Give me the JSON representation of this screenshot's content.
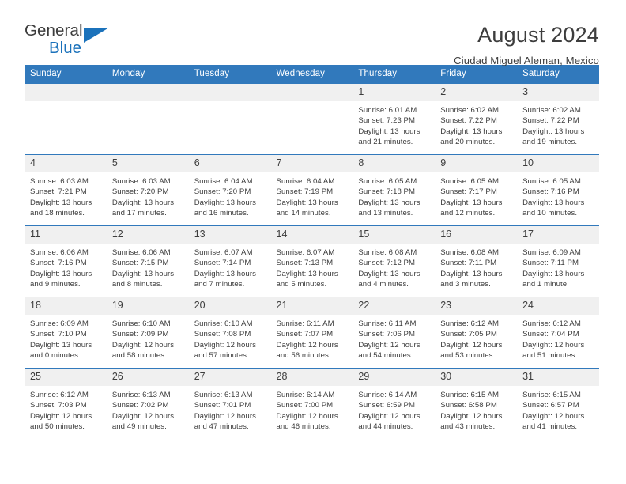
{
  "brand": {
    "name_part1": "General",
    "name_part2": "Blue",
    "accent_color": "#1b72bb"
  },
  "header": {
    "title": "August 2024",
    "subtitle": "Ciudad Miguel Aleman, Mexico"
  },
  "calendar": {
    "header_bg": "#3179bc",
    "daynum_bg": "#f0f0f0",
    "weekdays": [
      "Sunday",
      "Monday",
      "Tuesday",
      "Wednesday",
      "Thursday",
      "Friday",
      "Saturday"
    ],
    "weeks": [
      [
        {
          "day": "",
          "blank": true
        },
        {
          "day": "",
          "blank": true
        },
        {
          "day": "",
          "blank": true
        },
        {
          "day": "",
          "blank": true
        },
        {
          "day": "1",
          "sunrise": "Sunrise: 6:01 AM",
          "sunset": "Sunset: 7:23 PM",
          "daylight1": "Daylight: 13 hours",
          "daylight2": "and 21 minutes."
        },
        {
          "day": "2",
          "sunrise": "Sunrise: 6:02 AM",
          "sunset": "Sunset: 7:22 PM",
          "daylight1": "Daylight: 13 hours",
          "daylight2": "and 20 minutes."
        },
        {
          "day": "3",
          "sunrise": "Sunrise: 6:02 AM",
          "sunset": "Sunset: 7:22 PM",
          "daylight1": "Daylight: 13 hours",
          "daylight2": "and 19 minutes."
        }
      ],
      [
        {
          "day": "4",
          "sunrise": "Sunrise: 6:03 AM",
          "sunset": "Sunset: 7:21 PM",
          "daylight1": "Daylight: 13 hours",
          "daylight2": "and 18 minutes."
        },
        {
          "day": "5",
          "sunrise": "Sunrise: 6:03 AM",
          "sunset": "Sunset: 7:20 PM",
          "daylight1": "Daylight: 13 hours",
          "daylight2": "and 17 minutes."
        },
        {
          "day": "6",
          "sunrise": "Sunrise: 6:04 AM",
          "sunset": "Sunset: 7:20 PM",
          "daylight1": "Daylight: 13 hours",
          "daylight2": "and 16 minutes."
        },
        {
          "day": "7",
          "sunrise": "Sunrise: 6:04 AM",
          "sunset": "Sunset: 7:19 PM",
          "daylight1": "Daylight: 13 hours",
          "daylight2": "and 14 minutes."
        },
        {
          "day": "8",
          "sunrise": "Sunrise: 6:05 AM",
          "sunset": "Sunset: 7:18 PM",
          "daylight1": "Daylight: 13 hours",
          "daylight2": "and 13 minutes."
        },
        {
          "day": "9",
          "sunrise": "Sunrise: 6:05 AM",
          "sunset": "Sunset: 7:17 PM",
          "daylight1": "Daylight: 13 hours",
          "daylight2": "and 12 minutes."
        },
        {
          "day": "10",
          "sunrise": "Sunrise: 6:05 AM",
          "sunset": "Sunset: 7:16 PM",
          "daylight1": "Daylight: 13 hours",
          "daylight2": "and 10 minutes."
        }
      ],
      [
        {
          "day": "11",
          "sunrise": "Sunrise: 6:06 AM",
          "sunset": "Sunset: 7:16 PM",
          "daylight1": "Daylight: 13 hours",
          "daylight2": "and 9 minutes."
        },
        {
          "day": "12",
          "sunrise": "Sunrise: 6:06 AM",
          "sunset": "Sunset: 7:15 PM",
          "daylight1": "Daylight: 13 hours",
          "daylight2": "and 8 minutes."
        },
        {
          "day": "13",
          "sunrise": "Sunrise: 6:07 AM",
          "sunset": "Sunset: 7:14 PM",
          "daylight1": "Daylight: 13 hours",
          "daylight2": "and 7 minutes."
        },
        {
          "day": "14",
          "sunrise": "Sunrise: 6:07 AM",
          "sunset": "Sunset: 7:13 PM",
          "daylight1": "Daylight: 13 hours",
          "daylight2": "and 5 minutes."
        },
        {
          "day": "15",
          "sunrise": "Sunrise: 6:08 AM",
          "sunset": "Sunset: 7:12 PM",
          "daylight1": "Daylight: 13 hours",
          "daylight2": "and 4 minutes."
        },
        {
          "day": "16",
          "sunrise": "Sunrise: 6:08 AM",
          "sunset": "Sunset: 7:11 PM",
          "daylight1": "Daylight: 13 hours",
          "daylight2": "and 3 minutes."
        },
        {
          "day": "17",
          "sunrise": "Sunrise: 6:09 AM",
          "sunset": "Sunset: 7:11 PM",
          "daylight1": "Daylight: 13 hours",
          "daylight2": "and 1 minute."
        }
      ],
      [
        {
          "day": "18",
          "sunrise": "Sunrise: 6:09 AM",
          "sunset": "Sunset: 7:10 PM",
          "daylight1": "Daylight: 13 hours",
          "daylight2": "and 0 minutes."
        },
        {
          "day": "19",
          "sunrise": "Sunrise: 6:10 AM",
          "sunset": "Sunset: 7:09 PM",
          "daylight1": "Daylight: 12 hours",
          "daylight2": "and 58 minutes."
        },
        {
          "day": "20",
          "sunrise": "Sunrise: 6:10 AM",
          "sunset": "Sunset: 7:08 PM",
          "daylight1": "Daylight: 12 hours",
          "daylight2": "and 57 minutes."
        },
        {
          "day": "21",
          "sunrise": "Sunrise: 6:11 AM",
          "sunset": "Sunset: 7:07 PM",
          "daylight1": "Daylight: 12 hours",
          "daylight2": "and 56 minutes."
        },
        {
          "day": "22",
          "sunrise": "Sunrise: 6:11 AM",
          "sunset": "Sunset: 7:06 PM",
          "daylight1": "Daylight: 12 hours",
          "daylight2": "and 54 minutes."
        },
        {
          "day": "23",
          "sunrise": "Sunrise: 6:12 AM",
          "sunset": "Sunset: 7:05 PM",
          "daylight1": "Daylight: 12 hours",
          "daylight2": "and 53 minutes."
        },
        {
          "day": "24",
          "sunrise": "Sunrise: 6:12 AM",
          "sunset": "Sunset: 7:04 PM",
          "daylight1": "Daylight: 12 hours",
          "daylight2": "and 51 minutes."
        }
      ],
      [
        {
          "day": "25",
          "sunrise": "Sunrise: 6:12 AM",
          "sunset": "Sunset: 7:03 PM",
          "daylight1": "Daylight: 12 hours",
          "daylight2": "and 50 minutes."
        },
        {
          "day": "26",
          "sunrise": "Sunrise: 6:13 AM",
          "sunset": "Sunset: 7:02 PM",
          "daylight1": "Daylight: 12 hours",
          "daylight2": "and 49 minutes."
        },
        {
          "day": "27",
          "sunrise": "Sunrise: 6:13 AM",
          "sunset": "Sunset: 7:01 PM",
          "daylight1": "Daylight: 12 hours",
          "daylight2": "and 47 minutes."
        },
        {
          "day": "28",
          "sunrise": "Sunrise: 6:14 AM",
          "sunset": "Sunset: 7:00 PM",
          "daylight1": "Daylight: 12 hours",
          "daylight2": "and 46 minutes."
        },
        {
          "day": "29",
          "sunrise": "Sunrise: 6:14 AM",
          "sunset": "Sunset: 6:59 PM",
          "daylight1": "Daylight: 12 hours",
          "daylight2": "and 44 minutes."
        },
        {
          "day": "30",
          "sunrise": "Sunrise: 6:15 AM",
          "sunset": "Sunset: 6:58 PM",
          "daylight1": "Daylight: 12 hours",
          "daylight2": "and 43 minutes."
        },
        {
          "day": "31",
          "sunrise": "Sunrise: 6:15 AM",
          "sunset": "Sunset: 6:57 PM",
          "daylight1": "Daylight: 12 hours",
          "daylight2": "and 41 minutes."
        }
      ]
    ]
  }
}
